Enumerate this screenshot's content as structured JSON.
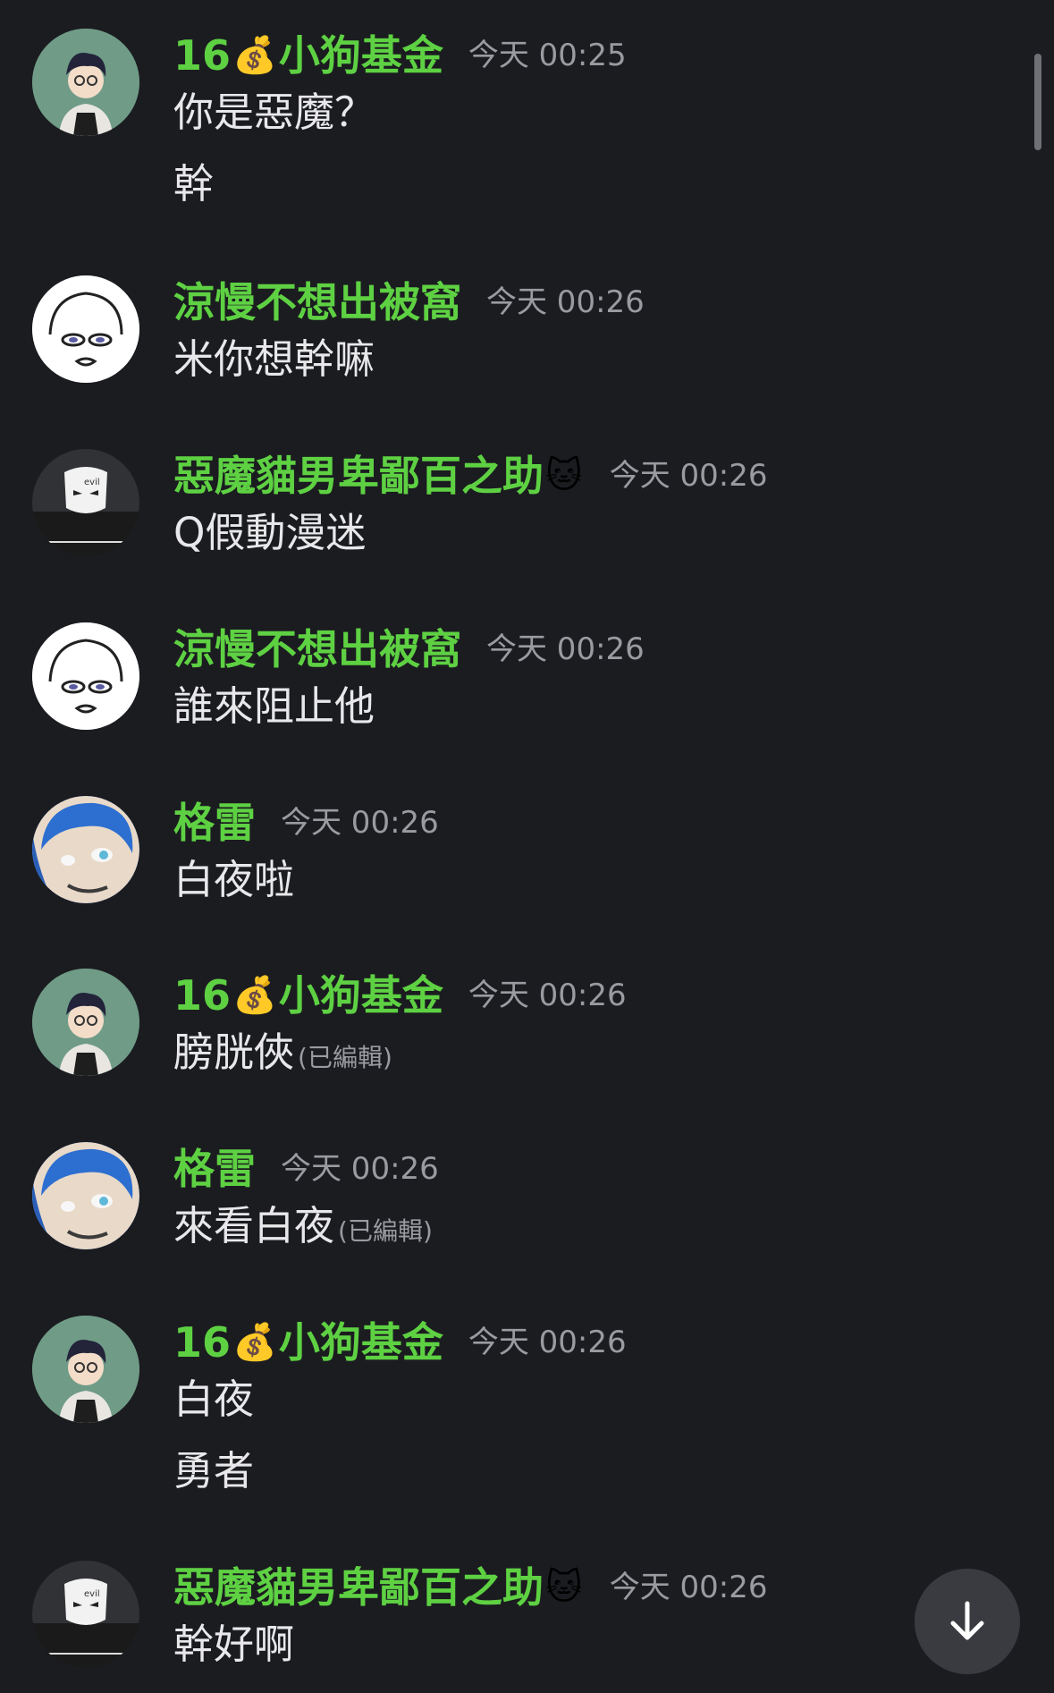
{
  "messages": [
    {
      "author": "16",
      "author_suffix": "小狗基金",
      "emoji": "💰",
      "time": "今天 00:25",
      "avatar": "glasses-guy",
      "lines": [
        {
          "text": "你是惡魔？",
          "edited": ""
        },
        {
          "text": "幹",
          "edited": ""
        }
      ]
    },
    {
      "author": "涼慢不想出被窩",
      "author_suffix": "",
      "emoji": "",
      "time": "今天 00:26",
      "avatar": "sketch-face",
      "lines": [
        {
          "text": "米你想幹嘛",
          "edited": ""
        }
      ]
    },
    {
      "author": "惡魔貓男卑鄙百之助",
      "author_suffix": "",
      "emoji": "🐱",
      "time": "今天 00:26",
      "avatar": "mask-photo",
      "lines": [
        {
          "text": "Q假動漫迷",
          "edited": ""
        }
      ]
    },
    {
      "author": "涼慢不想出被窩",
      "author_suffix": "",
      "emoji": "",
      "time": "今天 00:26",
      "avatar": "sketch-face",
      "lines": [
        {
          "text": "誰來阻止他",
          "edited": ""
        }
      ]
    },
    {
      "author": "格雷",
      "author_suffix": "",
      "emoji": "",
      "time": "今天 00:26",
      "avatar": "blue-plush",
      "lines": [
        {
          "text": "白夜啦",
          "edited": ""
        }
      ]
    },
    {
      "author": "16",
      "author_suffix": "小狗基金",
      "emoji": "💰",
      "time": "今天 00:26",
      "avatar": "glasses-guy",
      "lines": [
        {
          "text": "膀胱俠",
          "edited": "(已編輯)"
        }
      ]
    },
    {
      "author": "格雷",
      "author_suffix": "",
      "emoji": "",
      "time": "今天 00:26",
      "avatar": "blue-plush",
      "lines": [
        {
          "text": "來看白夜",
          "edited": "(已編輯)"
        }
      ]
    },
    {
      "author": "16",
      "author_suffix": "小狗基金",
      "emoji": "💰",
      "time": "今天 00:26",
      "avatar": "glasses-guy",
      "lines": [
        {
          "text": "白夜",
          "edited": ""
        },
        {
          "text": "勇者",
          "edited": ""
        }
      ]
    },
    {
      "author": "惡魔貓男卑鄙百之助",
      "author_suffix": "",
      "emoji": "🐱",
      "time": "今天 00:26",
      "avatar": "mask-photo",
      "lines": [
        {
          "text": "幹好啊",
          "edited": ""
        }
      ]
    }
  ],
  "icons": {
    "scroll_down": "arrow-down-icon"
  },
  "colors": {
    "background": "#1b1c20",
    "author": "#5ed143",
    "message": "#e8e8ea",
    "timestamp": "#9a9ba1",
    "fab": "#3a3b40"
  }
}
